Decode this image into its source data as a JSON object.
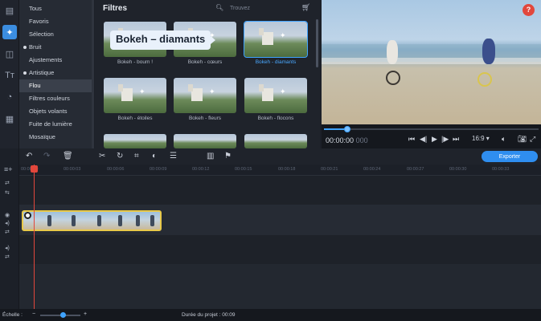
{
  "left_toolbar": {
    "icons": [
      {
        "name": "import-icon",
        "glyph": "▤"
      },
      {
        "name": "filters-magic-icon",
        "glyph": "✦"
      },
      {
        "name": "transitions-icon",
        "glyph": "◫"
      },
      {
        "name": "titles-icon",
        "glyph": "Tт"
      },
      {
        "name": "stickers-icon",
        "glyph": "◔"
      },
      {
        "name": "more-tools-icon",
        "glyph": "▦"
      }
    ]
  },
  "categories": [
    "Tous",
    "Favoris",
    "Sélection",
    "Bruit",
    "Ajustements",
    "Artistique",
    "Flou",
    "Filtres couleurs",
    "Objets volants",
    "Fuite de lumière",
    "Mosaïque"
  ],
  "filters": {
    "title": "Filtres",
    "search_placeholder": "Trouvez",
    "items": [
      "Bokeh - boum !",
      "Bokeh - cœurs",
      "Bokeh - diamants",
      "Bokeh - étoiles",
      "Bokeh - fleurs",
      "Bokeh - flocons"
    ],
    "tooltip": "Bokeh – diamants"
  },
  "preview": {
    "help_label": "?",
    "timecode": "00:00:00",
    "timecode_ms": "000",
    "progress_fraction": 0.11,
    "aspect_ratio": "16:9 ▾"
  },
  "timeline": {
    "export_label": "Exporter",
    "ruler_labels": [
      "00:00:00",
      "00:00:03",
      "00:00:06",
      "00:00:09",
      "00:00:12",
      "00:00:15",
      "00:00:18",
      "00:00:21",
      "00:00:24",
      "00:00:27",
      "00:00:30",
      "00:00:33"
    ]
  },
  "status": {
    "scale_label": "Échelle :",
    "scale_fraction": 0.55,
    "duration_label": "Durée du projet : 00:09"
  },
  "colors": {
    "accent": "#3fa3ff",
    "playhead": "#e2473c",
    "clip_border": "#e8c94a"
  }
}
